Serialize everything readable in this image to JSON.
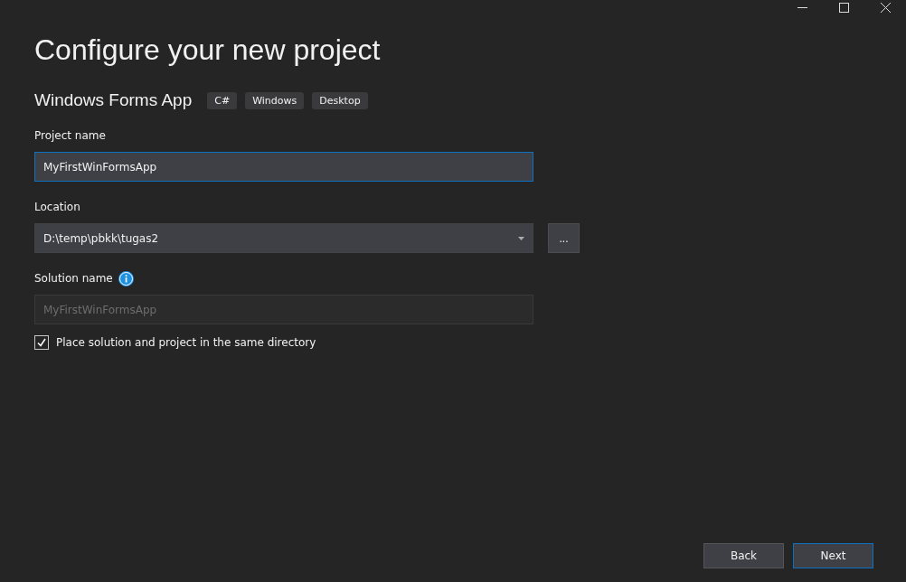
{
  "title": "Configure your new project",
  "template": {
    "name": "Windows Forms App",
    "tags": [
      "C#",
      "Windows",
      "Desktop"
    ]
  },
  "fields": [
    {
      "kind": "text",
      "label": "Project name",
      "value": "MyFirstWinFormsApp",
      "focused": true,
      "disabled": false
    },
    {
      "kind": "dropdown",
      "label": "Location",
      "value": "D:\\temp\\pbkk\\tugas2",
      "focused": false,
      "disabled": false,
      "browse": "..."
    },
    {
      "kind": "text",
      "label": "Solution name",
      "info": true,
      "placeholder": "MyFirstWinFormsApp",
      "focused": false,
      "disabled": true
    }
  ],
  "same_directory": {
    "label": "Place solution and project in the same directory",
    "checked": true
  },
  "buttons": [
    {
      "label": "Back",
      "primary": false
    },
    {
      "label": "Next",
      "primary": true
    }
  ]
}
